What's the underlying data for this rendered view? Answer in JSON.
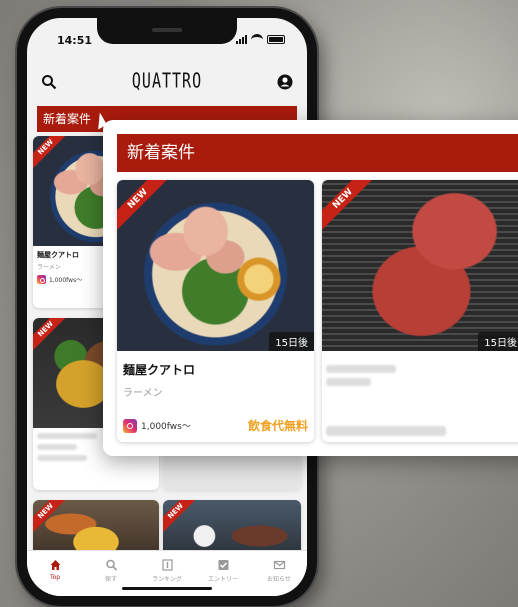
{
  "status": {
    "time": "14:51"
  },
  "app": {
    "logo": "QUATTRO"
  },
  "section": {
    "title": "新着案件"
  },
  "cards": [
    {
      "name": "麺屋クアトロ",
      "genre": "ラーメン",
      "followers": "1,000fws〜",
      "badge": "NEW"
    },
    {
      "badge": "NEW"
    },
    {
      "badge": "NEW"
    },
    {
      "badge": "NEW"
    }
  ],
  "callout": {
    "title": "新着案件",
    "cards": [
      {
        "badge": "NEW",
        "days": "15日後",
        "name": "麺屋クアトロ",
        "genre": "ラーメン",
        "followers": "1,000fws〜",
        "perk": "飲食代無料"
      },
      {
        "badge": "NEW",
        "days": "15日後"
      }
    ]
  },
  "tabbar": [
    {
      "label": "Top",
      "icon": "home-icon"
    },
    {
      "label": "探す",
      "icon": "search-icon"
    },
    {
      "label": "ランキング",
      "icon": "ranking-icon"
    },
    {
      "label": "エントリー",
      "icon": "check-icon"
    },
    {
      "label": "お知らせ",
      "icon": "mail-icon"
    }
  ],
  "colors": {
    "brand": "#a91b0d",
    "perk": "#f0a020"
  }
}
